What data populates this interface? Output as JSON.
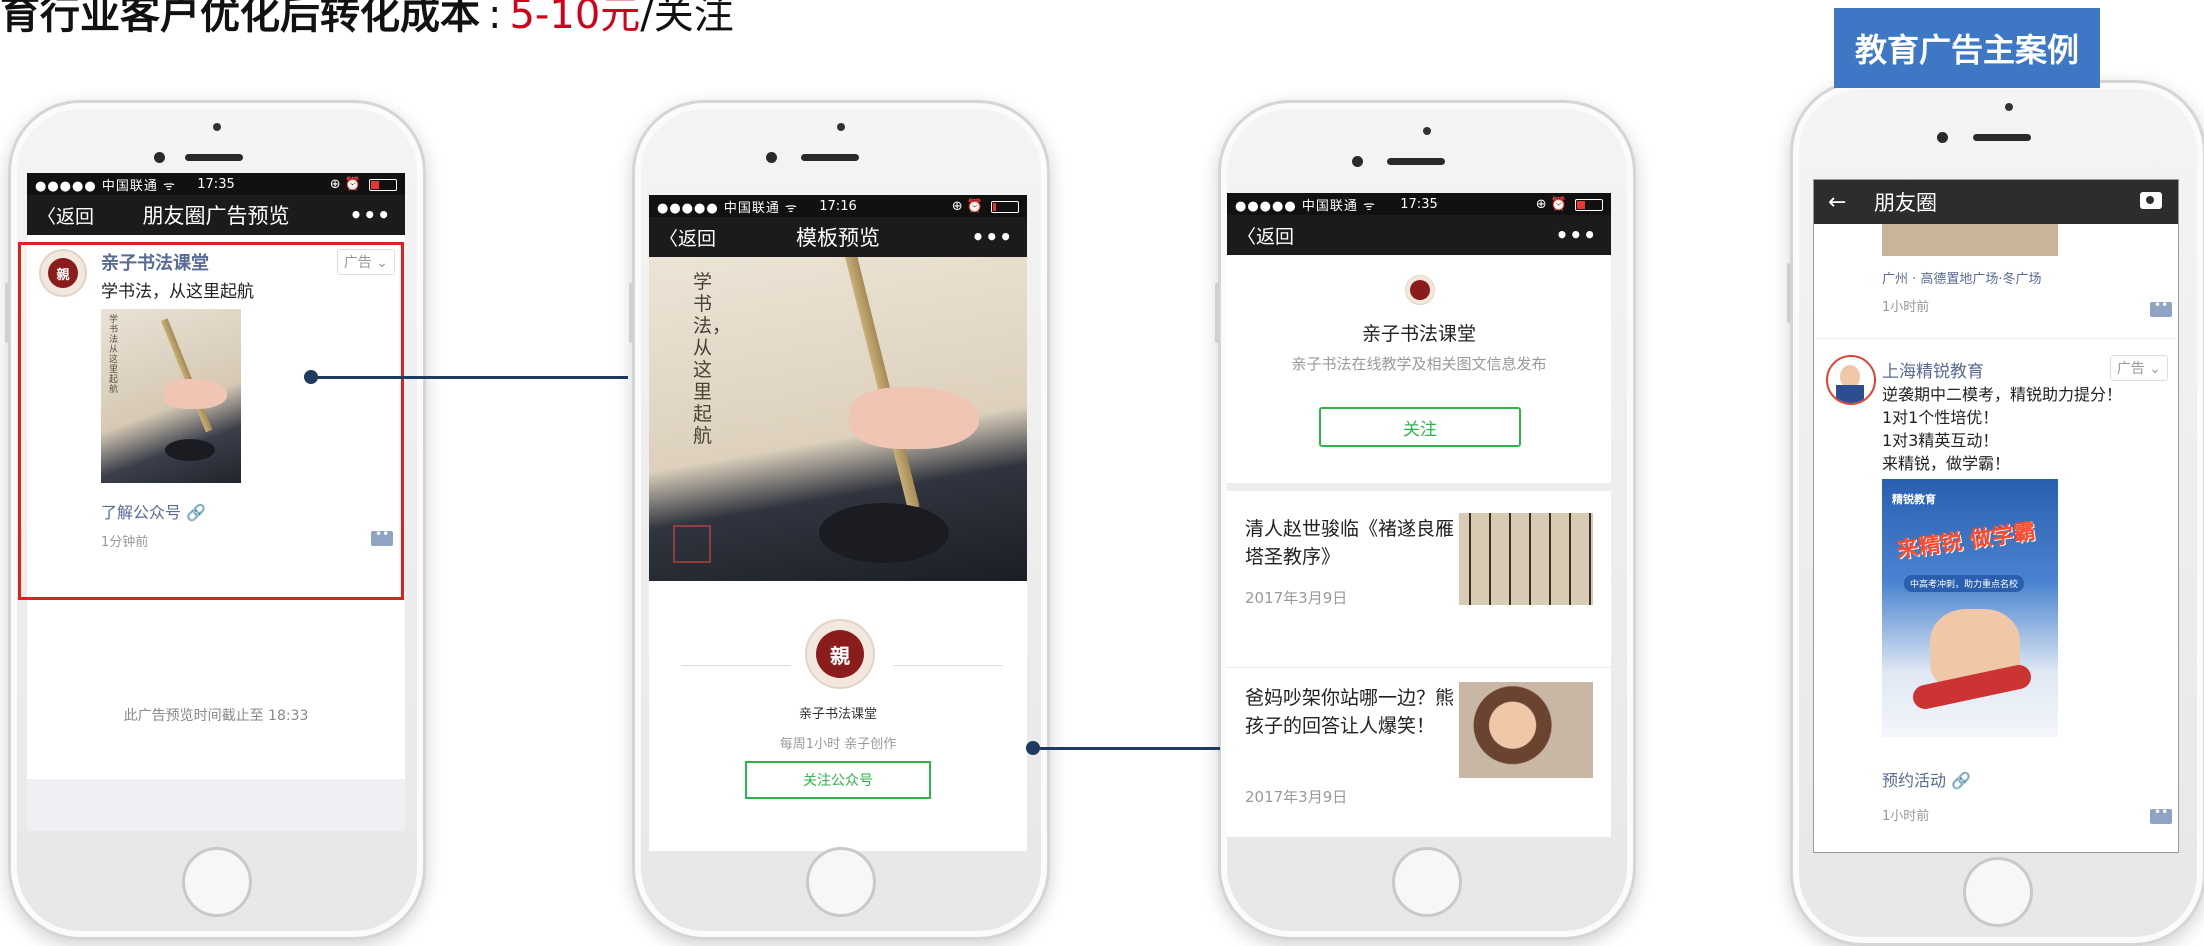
{
  "headline": {
    "text": "育行业客户优化后转化成本",
    "colon": ":",
    "price": "5-10元",
    "unit": "/关注"
  },
  "case_badge": "教育广告主案例",
  "colors": {
    "accent_blue": "#3e78c4",
    "price_red": "#d0021b",
    "wechat_green": "#2fb44a",
    "link_blue": "#576b95",
    "connector": "#1f3a5f"
  },
  "phone1": {
    "status": {
      "signal": "●●●●● 中国联通 ᯤ",
      "time": "17:35",
      "icons": "⊕ ⏰"
    },
    "nav": {
      "back": "〈返回",
      "title": "朋友圈广告预览",
      "more": "•••"
    },
    "post": {
      "avatar_text": "親",
      "name": "亲子书法课堂",
      "ad_tag": "广告 ⌄",
      "text": "学书法，从这里起航",
      "link": "了解公众号 🔗",
      "time": "1分钟前",
      "image_caption": "学书法 从这里起航"
    },
    "footer": "此广告预览时间截止至 18:33"
  },
  "phone2": {
    "status": {
      "signal": "●●●●● 中国联通 ᯤ",
      "time": "17:16",
      "icons": "⊕ ⏰"
    },
    "nav": {
      "back": "〈返回",
      "title": "模板预览",
      "more": "•••"
    },
    "hero_text": "学书法，从这里起航",
    "avatar_text": "親",
    "account_name": "亲子书法课堂",
    "subtitle": "每周1小时 亲子创作",
    "follow_button": "关注公众号"
  },
  "phone3": {
    "status": {
      "signal": "●●●●● 中国联通 ᯤ",
      "time": "17:35",
      "icons": "⊕ ⏰"
    },
    "nav": {
      "back": "〈返回",
      "more": "•••"
    },
    "account_name": "亲子书法课堂",
    "description": "亲子书法在线教学及相关图文信息发布",
    "follow_button": "关注",
    "articles": [
      {
        "title": "清人赵世骏临《褚遂良雁塔圣教序》",
        "date": "2017年3月9日"
      },
      {
        "title": "爸妈吵架你站哪一边？熊孩子的回答让人爆笑！",
        "date": "2017年3月9日"
      }
    ]
  },
  "phone4": {
    "nav": {
      "back": "←",
      "title": "朋友圈"
    },
    "prev_location": "广州 · 高德置地广场·冬广场",
    "prev_time": "1小时前",
    "post": {
      "name": "上海精锐教育",
      "ad_tag": "广告 ⌄",
      "lines": [
        "逆袭期中二模考，精锐助力提分！",
        "1对1个性培优！",
        "1对3精英互动！",
        "来精锐，做学霸！"
      ],
      "poster_logo": "精锐教育",
      "poster_title": "来精锐 做学霸",
      "poster_sub": "中高考冲刺，助力重点名校",
      "link": "预约活动 🔗",
      "time": "1小时前"
    }
  }
}
